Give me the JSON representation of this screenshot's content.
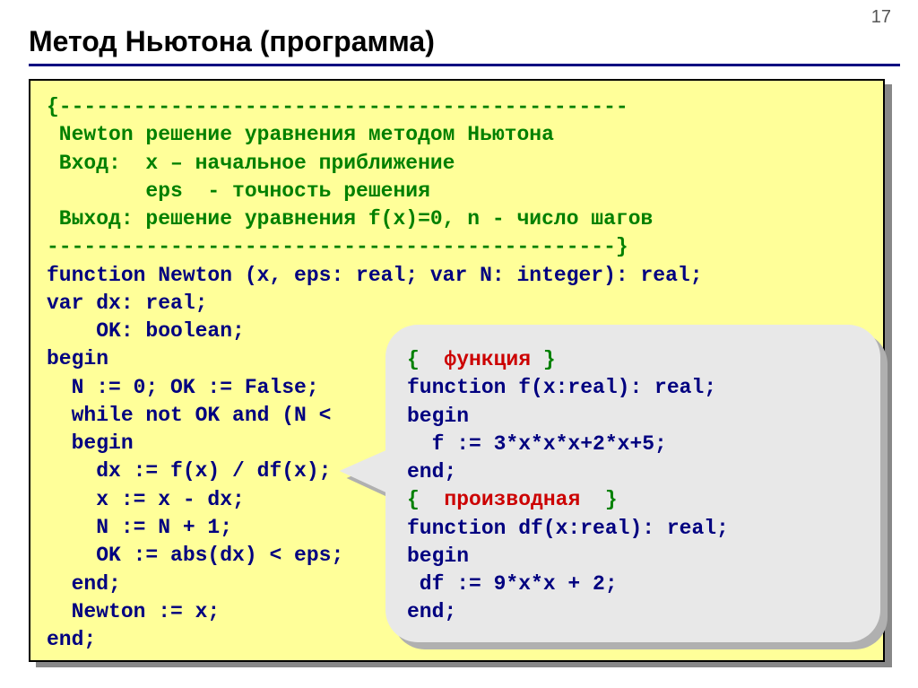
{
  "page_number": "17",
  "title": "Метод Ньютона (программа)",
  "comment_dash_open": "{----------------------------------------------",
  "comment_line1": " Newton решение уравнения методом Ньютона",
  "comment_line2a": " Вход:  x – начальное приближение",
  "comment_line2b": "        eps  - точность решения",
  "comment_line3": " Выход: решение уравнения f(x)=0, n - число шагов",
  "comment_dash_close": "----------------------------------------------}",
  "code_line1": "function Newton (x, eps: real; var N: integer): real;",
  "code_line2": "var dx: real;",
  "code_line3": "    OK: boolean;",
  "code_line4": "begin",
  "code_line5": "  N := 0; OK := False;",
  "code_line6": "  while not OK and (N <",
  "code_line7": "  begin",
  "code_line8": "    dx := f(x) / df(x);",
  "code_line9": "    x := x - dx;",
  "code_line10": "    N := N + 1;",
  "code_line11": "    OK := abs(dx) < eps;",
  "code_line12": "  end;",
  "code_line13": "  Newton := x;",
  "code_line14": "end;",
  "callout_c1a": "{  ",
  "callout_c1b": "функция",
  "callout_c1c": " }",
  "callout_l2": "function f(x:real): real;",
  "callout_l3": "begin",
  "callout_l4": "  f := 3*x*x*x+2*x+5;",
  "callout_l5": "end;",
  "callout_c2a": "{  ",
  "callout_c2b": "производная",
  "callout_c2c": "  }",
  "callout_l7": "function df(x:real): real;",
  "callout_l8": "begin",
  "callout_l9": " df := 9*x*x + 2;",
  "callout_l10": "end;"
}
